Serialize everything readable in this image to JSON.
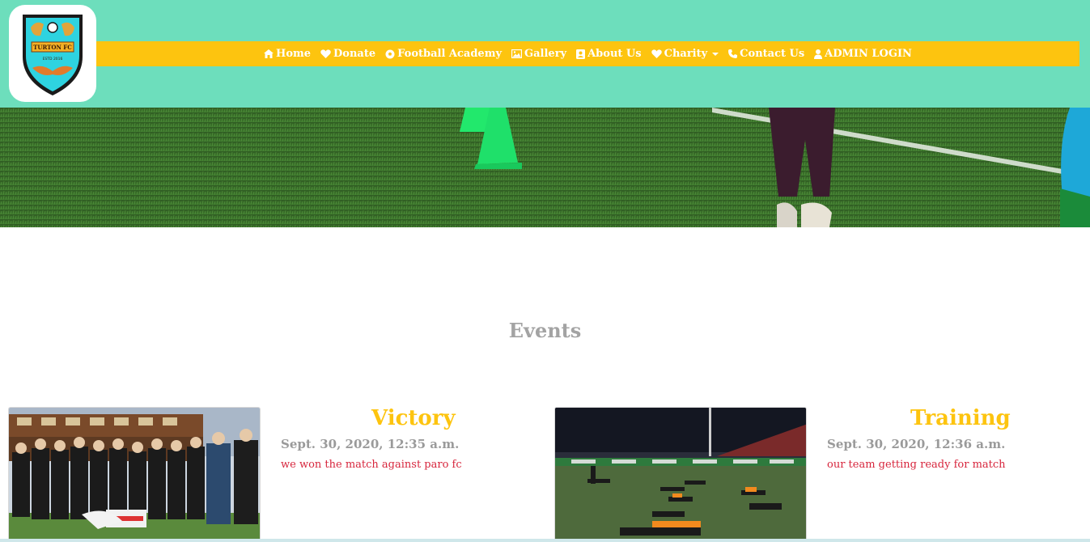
{
  "brand": {
    "logo_text": "TURTON FC",
    "logo_est": "ESTD 2016"
  },
  "nav": {
    "items": [
      {
        "label": "Home",
        "icon": "home-icon"
      },
      {
        "label": "Donate",
        "icon": "heart-icon"
      },
      {
        "label": "Football Academy",
        "icon": "football-icon"
      },
      {
        "label": "Gallery",
        "icon": "image-icon"
      },
      {
        "label": "About Us",
        "icon": "contact-card-icon"
      },
      {
        "label": "Charity",
        "icon": "heart-icon",
        "dropdown": true
      },
      {
        "label": "Contact Us",
        "icon": "phone-icon"
      },
      {
        "label": "ADMIN LOGIN",
        "icon": "user-icon"
      }
    ]
  },
  "events": {
    "heading": "Events",
    "items": [
      {
        "title": "Victory",
        "date": "Sept. 30, 2020, 12:35 a.m.",
        "description": "we won the match against paro fc",
        "image": "team-photo"
      },
      {
        "title": "Training",
        "date": "Sept. 30, 2020, 12:36 a.m.",
        "description": "our team getting ready for match",
        "image": "training-photo"
      }
    ]
  },
  "colors": {
    "header_bg": "#6ddebc",
    "nav_bg": "#fdc40f",
    "accent_title": "#fdc40f",
    "date_text": "#9a9a9a",
    "desc_text": "#d7263d"
  }
}
